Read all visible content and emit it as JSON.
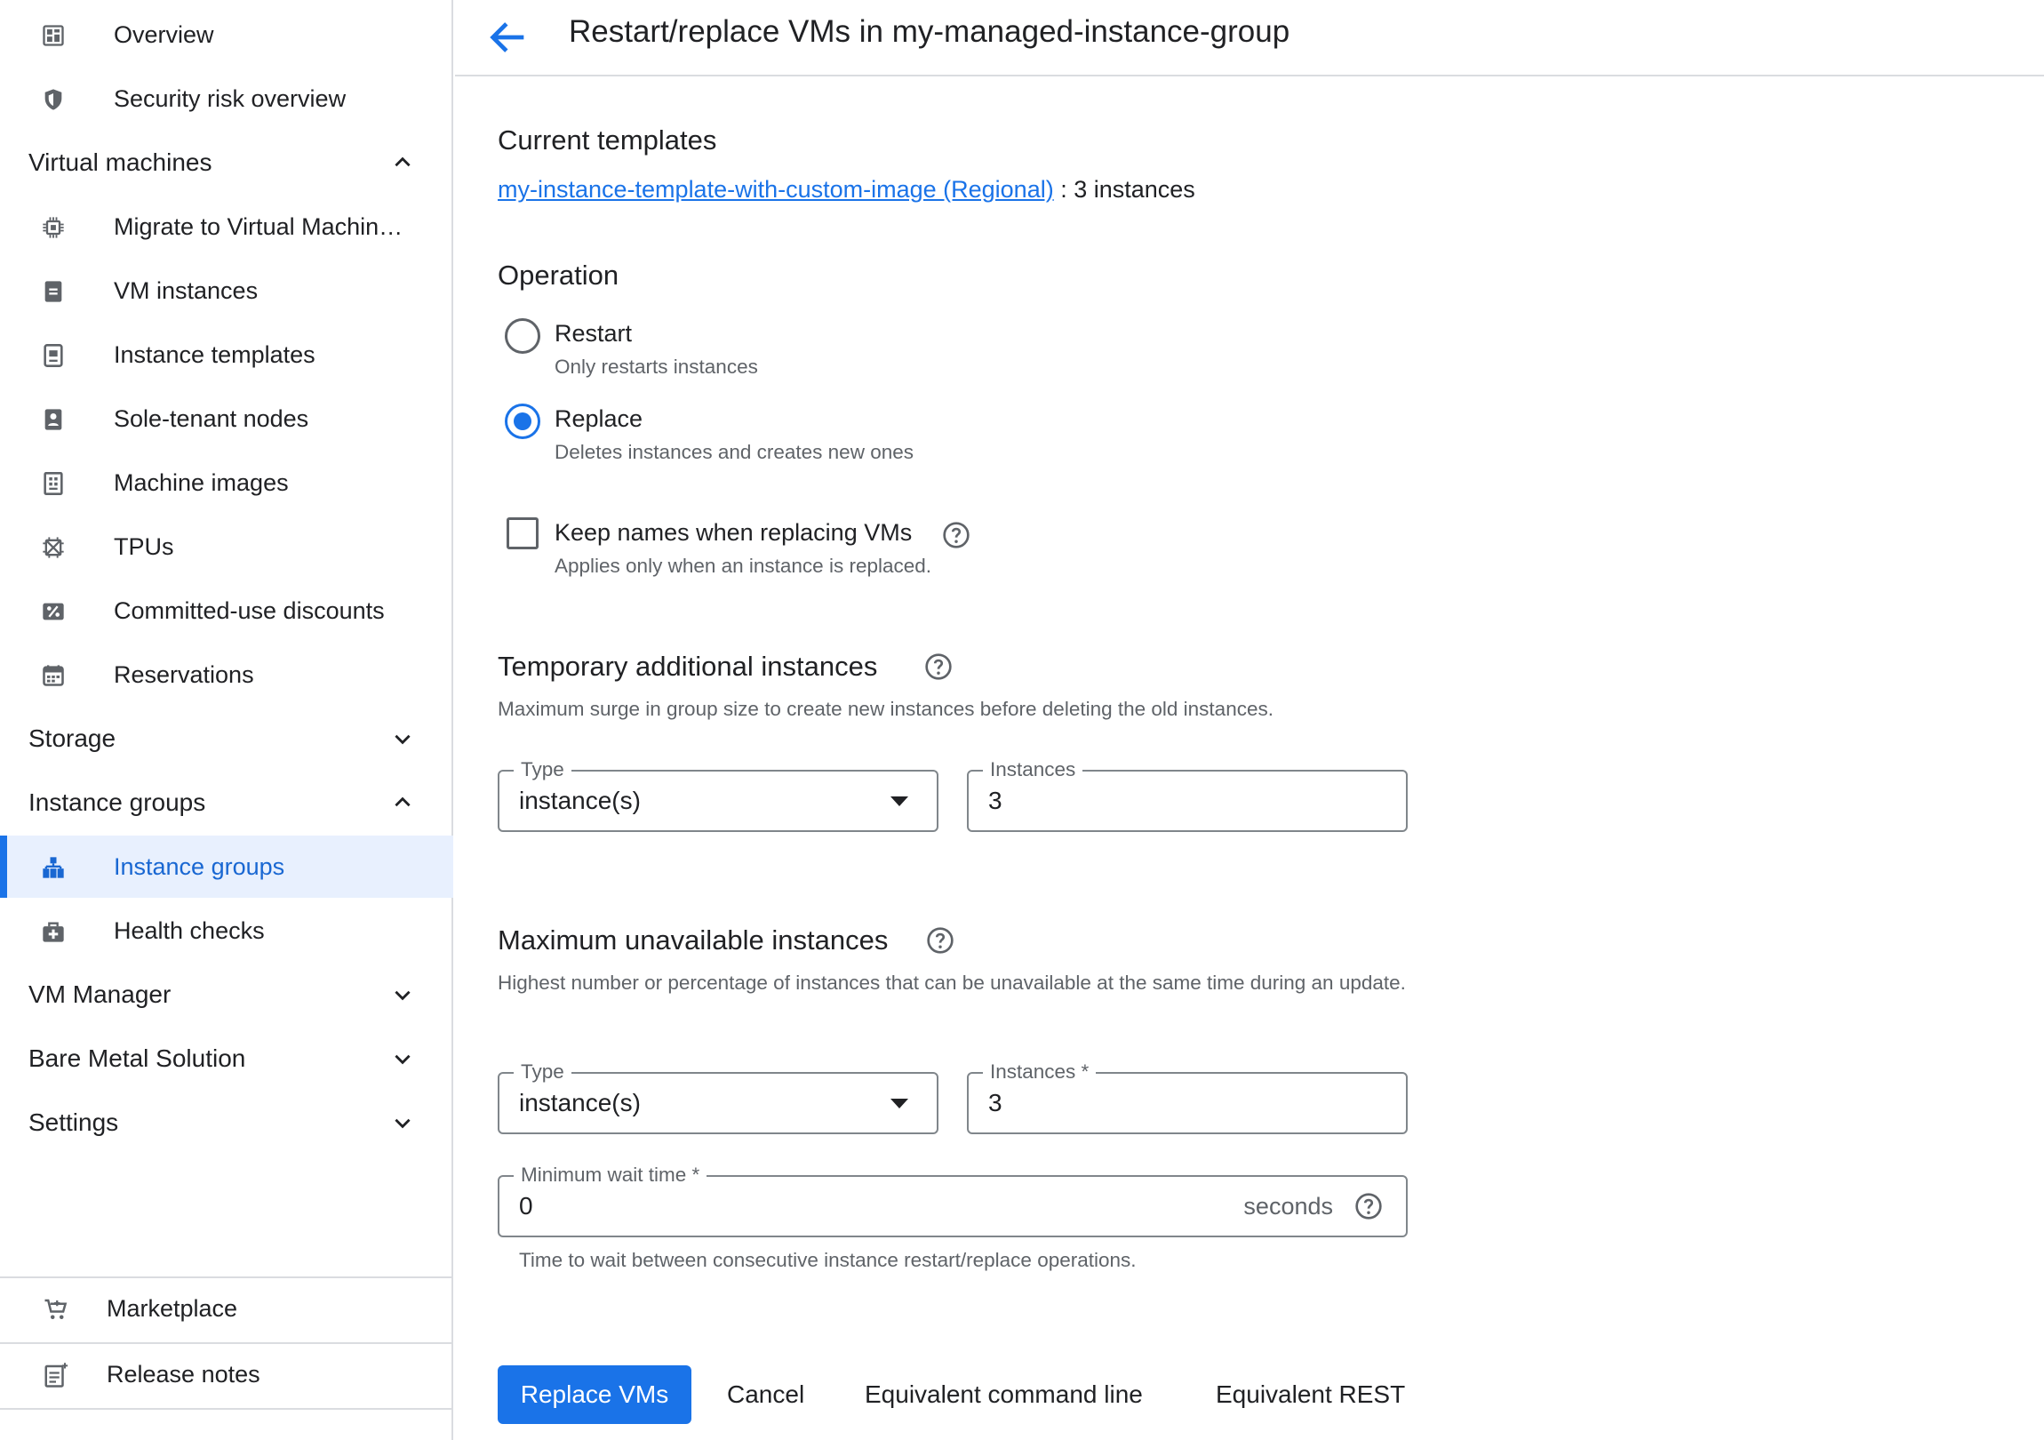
{
  "sidebar": {
    "items": [
      {
        "label": "Overview",
        "icon": "dashboard-icon"
      },
      {
        "label": "Security risk overview",
        "icon": "shield-icon"
      }
    ],
    "sections": {
      "virtual_machines": {
        "label": "Virtual machines",
        "expanded": true,
        "items": [
          {
            "label": "Migrate to Virtual Machin…",
            "icon": "migrate-chip-icon"
          },
          {
            "label": "VM instances",
            "icon": "vm-instance-icon"
          },
          {
            "label": "Instance templates",
            "icon": "instance-template-icon"
          },
          {
            "label": "Sole-tenant nodes",
            "icon": "sole-tenant-icon"
          },
          {
            "label": "Machine images",
            "icon": "machine-image-icon"
          },
          {
            "label": "TPUs",
            "icon": "tpu-icon"
          },
          {
            "label": "Committed-use discounts",
            "icon": "percent-icon"
          },
          {
            "label": "Reservations",
            "icon": "calendar-icon"
          }
        ]
      },
      "storage": {
        "label": "Storage",
        "expanded": false
      },
      "instance_groups": {
        "label": "Instance groups",
        "expanded": true,
        "items": [
          {
            "label": "Instance groups",
            "icon": "instance-groups-icon",
            "active": true
          },
          {
            "label": "Health checks",
            "icon": "medkit-icon"
          }
        ]
      },
      "vm_manager": {
        "label": "VM Manager",
        "expanded": false
      },
      "bare_metal": {
        "label": "Bare Metal Solution",
        "expanded": false
      },
      "settings": {
        "label": "Settings",
        "expanded": false
      }
    },
    "bottom": [
      {
        "label": "Marketplace",
        "icon": "cart-icon"
      },
      {
        "label": "Release notes",
        "icon": "release-notes-icon"
      }
    ]
  },
  "header": {
    "title": "Restart/replace VMs in my-managed-instance-group"
  },
  "current_templates": {
    "heading": "Current templates",
    "link": "my-instance-template-with-custom-image (Regional)",
    "count": " : 3 instances"
  },
  "operation": {
    "heading": "Operation",
    "options": [
      {
        "label": "Restart",
        "sub": "Only restarts instances",
        "checked": false
      },
      {
        "label": "Replace",
        "sub": "Deletes instances and creates new ones",
        "checked": true
      }
    ],
    "keep_names": {
      "label": "Keep names when replacing VMs",
      "sub": "Applies only when an instance is replaced.",
      "checked": false
    }
  },
  "surge": {
    "heading": "Temporary additional instances",
    "desc": "Maximum surge in group size to create new instances before deleting the old instances.",
    "type_label": "Type",
    "type_value": "instance(s)",
    "instances_label": "Instances",
    "instances_value": "3"
  },
  "unavailable": {
    "heading": "Maximum unavailable instances",
    "desc": "Highest number or percentage of instances that can be unavailable at the same time during an update.",
    "type_label": "Type",
    "type_value": "instance(s)",
    "instances_label": "Instances *",
    "instances_value": "3"
  },
  "wait": {
    "label": "Minimum wait time *",
    "value": "0",
    "suffix": "seconds",
    "help": "Time to wait between consecutive instance restart/replace operations."
  },
  "actions": {
    "primary": "Replace VMs",
    "cancel": "Cancel",
    "cli": "Equivalent command line",
    "rest": "Equivalent REST"
  },
  "colors": {
    "accent": "#1a73e8",
    "active_bg": "#e8f0fe",
    "text": "#202124",
    "muted": "#5f6368",
    "divider": "#dadce0"
  }
}
